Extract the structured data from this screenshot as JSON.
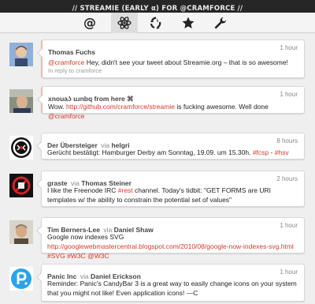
{
  "header": {
    "title": "// STREAMIE (EARLY α) FOR @CRAMFORCE //"
  },
  "tabs": [
    {
      "name": "mentions",
      "icon": "at-icon",
      "active": false
    },
    {
      "name": "home",
      "icon": "atom-icon",
      "active": true
    },
    {
      "name": "retweets",
      "icon": "recycle-icon",
      "active": false
    },
    {
      "name": "favorites",
      "icon": "star-icon",
      "active": false
    },
    {
      "name": "settings",
      "icon": "wrench-icon",
      "active": false
    }
  ],
  "tweets": [
    {
      "user": "Thomas Fuchs",
      "via": "",
      "via_user": "",
      "time": "1 hour",
      "text": [
        {
          "t": "@cramforce",
          "c": "link"
        },
        {
          "t": " Hey, didn't see your tweet about Streamie.org – that is so awesome!",
          "c": ""
        }
      ],
      "reply_to": "In reply to cramforce",
      "mention": true
    },
    {
      "user": "xnouaʖ uɹnbq from here ⌘",
      "via": "",
      "via_user": "",
      "time": "1 hour",
      "text": [
        {
          "t": "Wow. ",
          "c": ""
        },
        {
          "t": "http://github.com/cramforce/streamie",
          "c": "link"
        },
        {
          "t": " is fucking awesome. Well done ",
          "c": ""
        },
        {
          "t": "@cramforce",
          "c": "link"
        }
      ],
      "reply_to": "",
      "mention": true
    },
    {
      "user": "Der Übersteiger",
      "via": "via",
      "via_user": "helgri",
      "time": "8 hours",
      "text": [
        {
          "t": "Gerücht bestätigt: Hamburger Derby am Sonntag, 19.09. um 15.30h. ",
          "c": ""
        },
        {
          "t": "#fcsp",
          "c": "hashtag"
        },
        {
          "t": " - ",
          "c": ""
        },
        {
          "t": "#hsv",
          "c": "hashtag"
        }
      ],
      "reply_to": "",
      "mention": false
    },
    {
      "user": "graste",
      "via": "via",
      "via_user": "Thomas Steiner",
      "time": "2 hours",
      "text": [
        {
          "t": "I like the Freenode IRC ",
          "c": ""
        },
        {
          "t": "#rest",
          "c": "hashtag"
        },
        {
          "t": " channel. Today's tidbit: \"GET FORMS are URI templates w/ the ability to constrain the potential set of values\"",
          "c": ""
        }
      ],
      "reply_to": "",
      "mention": false
    },
    {
      "user": "Tim Berners-Lee",
      "via": "via",
      "via_user": "Daniel Shaw",
      "time": "1 hour",
      "text": [
        {
          "t": "Google now indexes SVG ",
          "c": ""
        },
        {
          "t": "http://googlewebmastercentral.blogspot.com/2010/08/google-now-indexes-svg.html",
          "c": "link"
        },
        {
          "t": " ",
          "c": ""
        },
        {
          "t": "#SVG",
          "c": "hashtag"
        },
        {
          "t": " ",
          "c": ""
        },
        {
          "t": "#W3C",
          "c": "hashtag"
        },
        {
          "t": " ",
          "c": ""
        },
        {
          "t": "@W3C",
          "c": "link"
        }
      ],
      "reply_to": "",
      "mention": false
    },
    {
      "user": "Panic Inc",
      "via": "via",
      "via_user": "Daniel Erickson",
      "time": "1 hour",
      "text": [
        {
          "t": "Reminder: Panic's CandyBar 3 is a great way to easily change icons on your system that you might not like! Even application icons! —C",
          "c": ""
        }
      ],
      "reply_to": "",
      "mention": false
    }
  ],
  "colors": {
    "accent": "#d33a2c",
    "header_bg": "#262626",
    "mention_border": "#f0b8b4"
  }
}
